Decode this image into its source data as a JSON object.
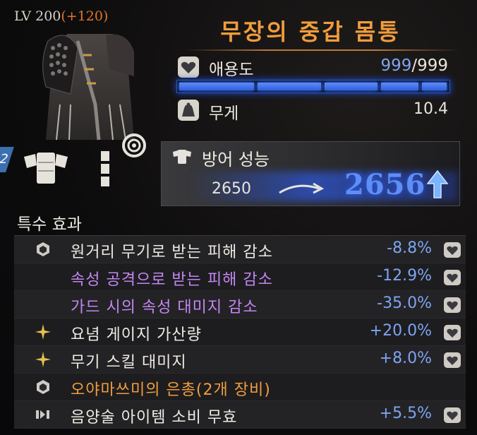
{
  "level": {
    "base": "LV 200",
    "bonus": "(+120)"
  },
  "item": {
    "name": "무장의 중갑 몸통"
  },
  "affection": {
    "label": "애용도",
    "current": "999",
    "max": "/999",
    "fill": 1.0
  },
  "weight": {
    "label": "무게",
    "value": "10.4"
  },
  "defense": {
    "label": "방어 성능",
    "old_value": "2650",
    "new_value": "2656"
  },
  "slot_badge": "2",
  "special": {
    "title": "특수 효과",
    "effects": [
      {
        "icon": "hexagon-icon",
        "label": "원거리 무기로 받는 피해 감소",
        "value": "-8.8%",
        "color": "white",
        "mark": true
      },
      {
        "icon": "",
        "label": "속성 공격으로 받는 피해 감소",
        "value": "-12.9%",
        "color": "purple",
        "mark": true
      },
      {
        "icon": "",
        "label": "가드 시의 속성 대미지 감소",
        "value": "-35.0%",
        "color": "purple",
        "mark": true
      },
      {
        "icon": "sparkle-icon",
        "label": "요념 게이지 가산량",
        "value": "+20.0%",
        "color": "white",
        "mark": true
      },
      {
        "icon": "sparkle-icon",
        "label": "무기 스킬 대미지",
        "value": "+8.0%",
        "color": "white",
        "mark": true
      },
      {
        "icon": "hexagon-icon",
        "label": "오야마쓰미의 은총(2개 장비)",
        "value": "",
        "color": "orange",
        "mark": false
      },
      {
        "icon": "media-icon",
        "label": "음양술 아이템 소비 무효",
        "value": "+5.5%",
        "color": "white",
        "mark": true
      }
    ]
  },
  "colors": {
    "accent_orange": "#f09d3c",
    "value_blue": "#7ea4f0",
    "purple_text": "#c487f0",
    "bar_blue": "#2f5fe0"
  }
}
